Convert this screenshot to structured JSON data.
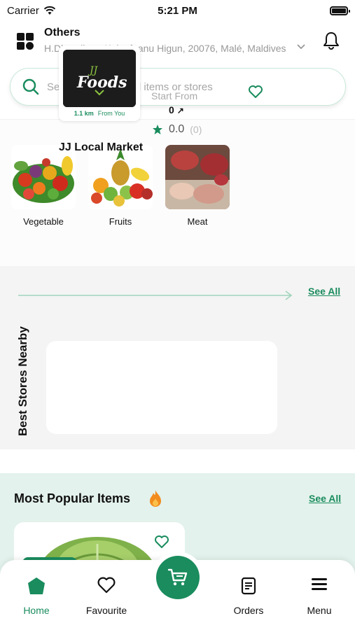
{
  "status_bar": {
    "carrier": "Carrier",
    "time": "5:21 PM"
  },
  "header": {
    "title": "Others",
    "address": "H.Dhoorihaa, Kalaafaanu Higun, 20076, Malé, Maldives"
  },
  "search": {
    "placeholder": "Search your desired items or stores"
  },
  "categories": [
    {
      "label": "Vegetable"
    },
    {
      "label": "Fruits"
    },
    {
      "label": "Meat"
    }
  ],
  "stores": {
    "title": "Best Stores Nearby",
    "see_all": "See All",
    "store": {
      "logo_text": "Foods",
      "logo_mark": "JJ",
      "distance": "1.1 km",
      "distance_suffix": "From You",
      "start_from_label": "Start From",
      "start_price": "0",
      "rating": "0.0",
      "rating_count": "(0)",
      "name": "JJ Local Market"
    }
  },
  "popular": {
    "title": "Most Popular Items",
    "see_all": "See All"
  },
  "bottom_nav": {
    "home": "Home",
    "favourite": "Favourite",
    "orders": "Orders",
    "menu": "Menu"
  },
  "colors": {
    "accent": "#1a8c5e",
    "popular_bg": "#e3f2ec",
    "stores_bg": "#f4f4f4"
  }
}
